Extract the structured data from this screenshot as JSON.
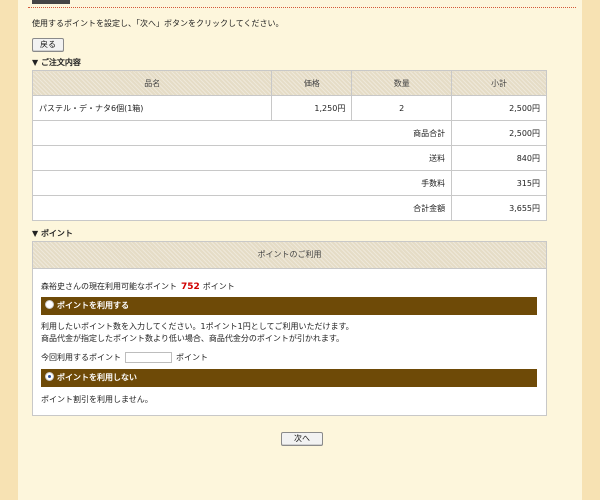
{
  "instruction": "使用するポイントを設定し、「次へ」ボタンをクリックしてください。",
  "buttons": {
    "back": "戻る",
    "next": "次へ"
  },
  "order": {
    "heading": "▼ ご注文内容",
    "columns": [
      "品名",
      "価格",
      "数量",
      "小計"
    ],
    "items": [
      {
        "name": "パステル・デ・ナタ6個(1箱)",
        "price": "1,250円",
        "qty": "2",
        "subtotal": "2,500円"
      }
    ],
    "summary": [
      {
        "label": "商品合計",
        "value": "2,500円"
      },
      {
        "label": "送料",
        "value": "840円"
      },
      {
        "label": "手数料",
        "value": "315円"
      },
      {
        "label": "合計金額",
        "value": "3,655円"
      }
    ]
  },
  "points": {
    "heading": "▼ ポイント",
    "box_title": "ポイントのご利用",
    "available_prefix": "森裕史さんの現在利用可能なポイント",
    "available_value": "752",
    "available_suffix": "ポイント",
    "option_use": "ポイントを利用する",
    "use_desc_1": "利用したいポイント数を入力してください。1ポイント1円としてご利用いただけます。",
    "use_desc_2": "商品代金が指定したポイント数より低い場合、商品代金分のポイントが引かれます。",
    "enter_prefix": "今回利用するポイント",
    "enter_value": "",
    "enter_suffix": "ポイント",
    "option_nouse": "ポイントを利用しない",
    "selected_option": "nouse",
    "nouse_msg": "ポイント割引を利用しません。"
  },
  "colors": {
    "option_bar": "#6e4a07",
    "points_number": "#d00000",
    "page_bg": "#f7e2b3"
  }
}
